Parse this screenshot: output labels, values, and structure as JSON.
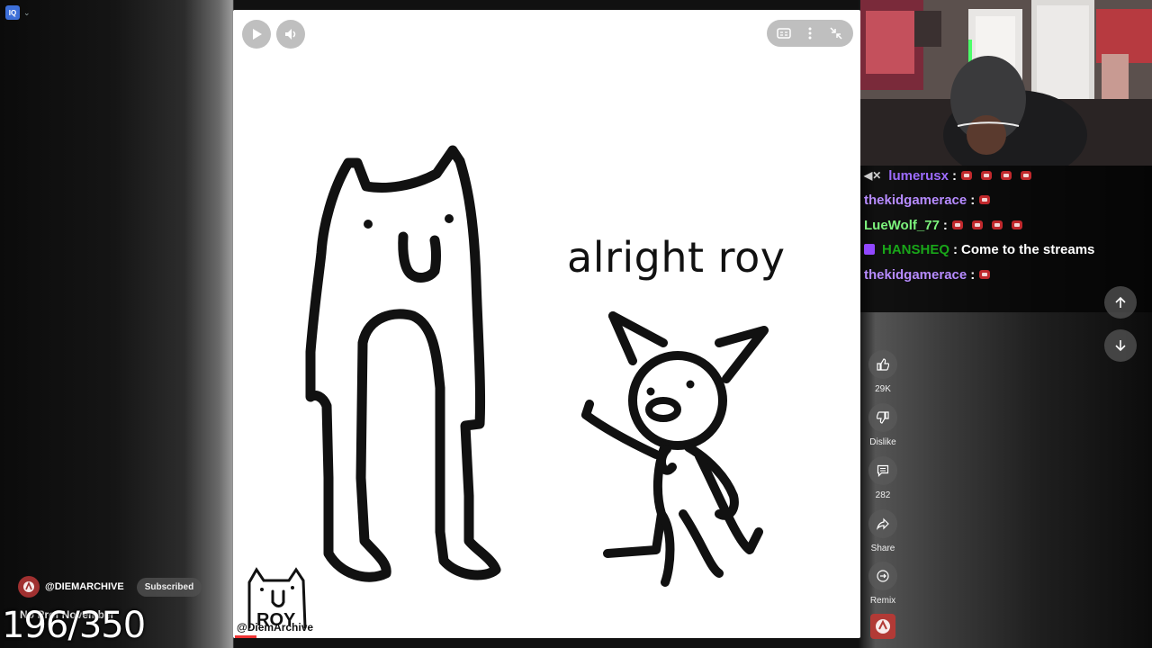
{
  "app": {
    "extension_badge": "IQ"
  },
  "video": {
    "caption_text": "alright roy",
    "watermark_label": "ROY",
    "watermark_handle": "@DiemArchive",
    "controls": {
      "play_icon": "play-icon",
      "volume_icon": "volume-icon",
      "cc_icon": "captions-icon",
      "more_icon": "more-vert-icon",
      "exit_fullscreen_icon": "collapse-icon"
    }
  },
  "chat": {
    "messages": [
      {
        "user": "lumerusx",
        "user_color": "#a970ff",
        "text": "",
        "emotes": 4,
        "badge": "mute"
      },
      {
        "user": "thekidgamerace",
        "user_color": "#b68bff",
        "text": "",
        "emotes": 1,
        "badge": ""
      },
      {
        "user": "LueWolf_77",
        "user_color": "#7cf27c",
        "text": "",
        "emotes": 4,
        "badge": ""
      },
      {
        "user": "HANSHEQ",
        "user_color": "#19a619",
        "text": "Come to the streams",
        "emotes": 0,
        "badge": "purple"
      },
      {
        "user": "thekidgamerace",
        "user_color": "#b68bff",
        "text": "",
        "emotes": 1,
        "badge": ""
      }
    ],
    "separator": ":"
  },
  "actions": {
    "like": {
      "icon": "thumbs-up-icon",
      "label": "29K"
    },
    "dislike": {
      "icon": "thumbs-down-icon",
      "label": "Dislike"
    },
    "comments": {
      "icon": "comment-icon",
      "label": "282"
    },
    "share": {
      "icon": "share-icon",
      "label": "Share"
    },
    "remix": {
      "icon": "remix-icon",
      "label": "Remix"
    }
  },
  "channel": {
    "handle": "@DIEMARCHIVE",
    "subscribe_label": "Subscribed",
    "overlay_text": "No Prof November",
    "counter": "196/350"
  }
}
